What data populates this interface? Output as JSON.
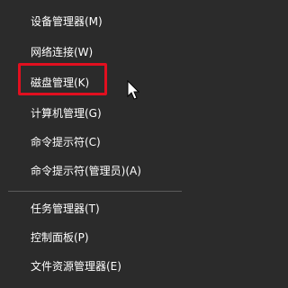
{
  "menu": {
    "items": [
      {
        "label": "设备管理器(M)"
      },
      {
        "label": "网络连接(W)"
      },
      {
        "label": "磁盘管理(K)"
      },
      {
        "label": "计算机管理(G)"
      },
      {
        "label": "命令提示符(C)"
      },
      {
        "label": "命令提示符(管理员)(A)"
      },
      {
        "label": "任务管理器(T)"
      },
      {
        "label": "控制面板(P)"
      },
      {
        "label": "文件资源管理器(E)"
      }
    ]
  },
  "colors": {
    "background": "#2b2b2b",
    "text": "#ffffff",
    "highlight_border": "#e10f1f",
    "separator": "#5a5a5a"
  },
  "icons": {
    "cursor": "mouse-pointer-icon"
  }
}
